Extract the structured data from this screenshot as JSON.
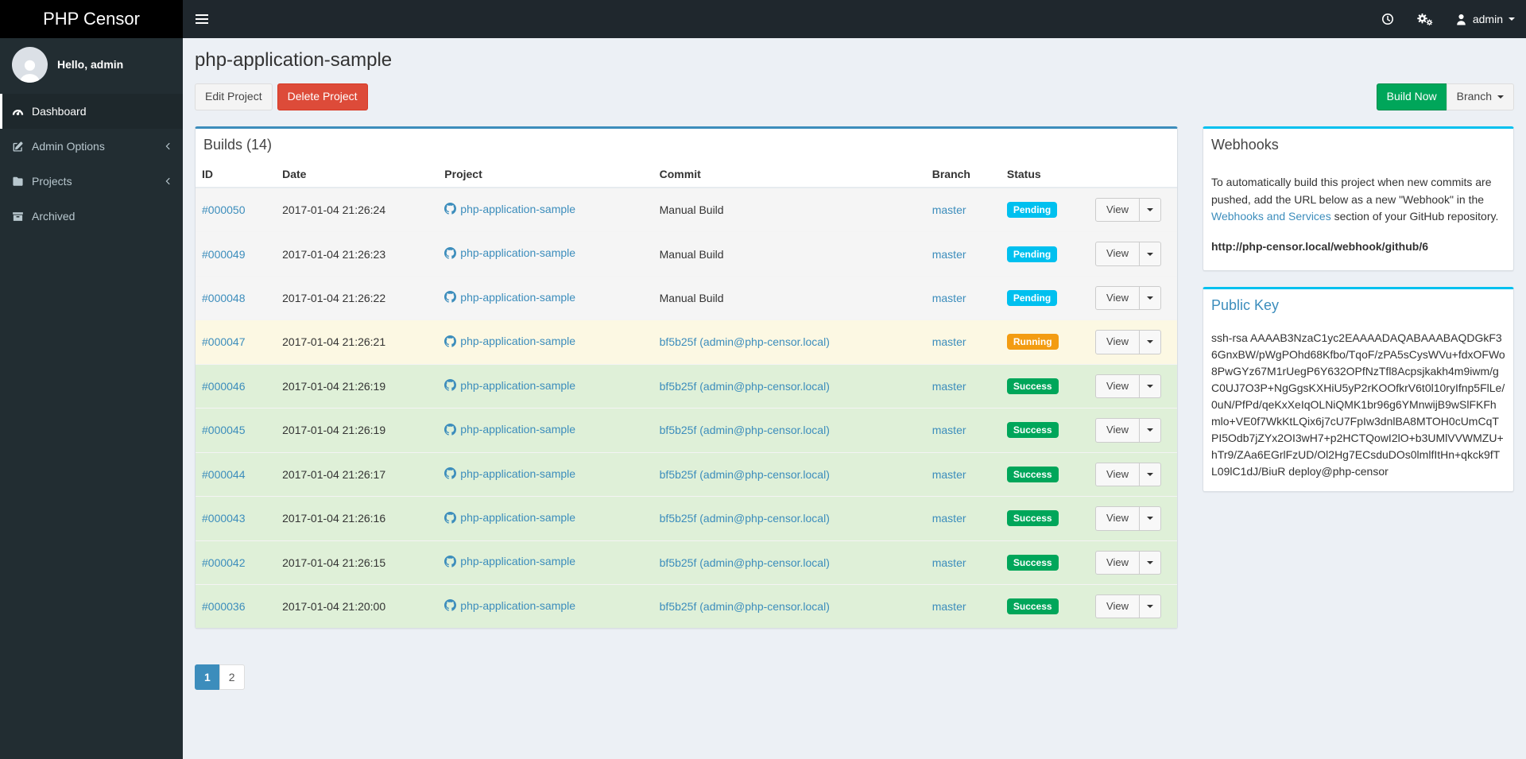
{
  "colors": {
    "accent": "#3c8dbc",
    "info": "#00c0ef",
    "warning": "#f39c12",
    "success": "#00a65a",
    "danger": "#dd4b39",
    "navbar_bg": "#1f272d",
    "sidebar_bg": "#222d32",
    "logo_bg": "#000000"
  },
  "brand": {
    "title": "PHP Censor"
  },
  "navbar": {
    "user_label": "admin",
    "icons": {
      "menu": "hamburger-icon",
      "history": "clock-icon",
      "settings": "cogs-icon",
      "user": "user-icon",
      "dropdown": "chevron-down-icon"
    }
  },
  "sidebar": {
    "greeting": "Hello, admin",
    "items": [
      {
        "label": "Dashboard",
        "icon": "gauge-icon",
        "active": true,
        "chevron": false
      },
      {
        "label": "Admin Options",
        "icon": "edit-icon",
        "active": false,
        "chevron": true
      },
      {
        "label": "Projects",
        "icon": "folder-icon",
        "active": false,
        "chevron": true
      },
      {
        "label": "Archived",
        "icon": "archive-icon",
        "active": false,
        "chevron": false
      }
    ]
  },
  "page": {
    "title": "php-application-sample",
    "buttons": {
      "edit": "Edit Project",
      "delete": "Delete Project",
      "build_now": "Build Now",
      "branch": "Branch"
    }
  },
  "builds": {
    "title": "Builds (14)",
    "columns": {
      "id": "ID",
      "date": "Date",
      "project": "Project",
      "commit": "Commit",
      "branch": "Branch",
      "status": "Status"
    },
    "view_button": "View",
    "rows": [
      {
        "id": "#000050",
        "date": "2017-01-04 21:26:24",
        "project": "php-application-sample",
        "commit": "Manual Build",
        "commit_link": false,
        "branch": "master",
        "status": "Pending"
      },
      {
        "id": "#000049",
        "date": "2017-01-04 21:26:23",
        "project": "php-application-sample",
        "commit": "Manual Build",
        "commit_link": false,
        "branch": "master",
        "status": "Pending"
      },
      {
        "id": "#000048",
        "date": "2017-01-04 21:26:22",
        "project": "php-application-sample",
        "commit": "Manual Build",
        "commit_link": false,
        "branch": "master",
        "status": "Pending"
      },
      {
        "id": "#000047",
        "date": "2017-01-04 21:26:21",
        "project": "php-application-sample",
        "commit": "bf5b25f (admin@php-censor.local)",
        "commit_link": true,
        "branch": "master",
        "status": "Running"
      },
      {
        "id": "#000046",
        "date": "2017-01-04 21:26:19",
        "project": "php-application-sample",
        "commit": "bf5b25f (admin@php-censor.local)",
        "commit_link": true,
        "branch": "master",
        "status": "Success"
      },
      {
        "id": "#000045",
        "date": "2017-01-04 21:26:19",
        "project": "php-application-sample",
        "commit": "bf5b25f (admin@php-censor.local)",
        "commit_link": true,
        "branch": "master",
        "status": "Success"
      },
      {
        "id": "#000044",
        "date": "2017-01-04 21:26:17",
        "project": "php-application-sample",
        "commit": "bf5b25f (admin@php-censor.local)",
        "commit_link": true,
        "branch": "master",
        "status": "Success"
      },
      {
        "id": "#000043",
        "date": "2017-01-04 21:26:16",
        "project": "php-application-sample",
        "commit": "bf5b25f (admin@php-censor.local)",
        "commit_link": true,
        "branch": "master",
        "status": "Success"
      },
      {
        "id": "#000042",
        "date": "2017-01-04 21:26:15",
        "project": "php-application-sample",
        "commit": "bf5b25f (admin@php-censor.local)",
        "commit_link": true,
        "branch": "master",
        "status": "Success"
      },
      {
        "id": "#000036",
        "date": "2017-01-04 21:20:00",
        "project": "php-application-sample",
        "commit": "bf5b25f (admin@php-censor.local)",
        "commit_link": true,
        "branch": "master",
        "status": "Success"
      }
    ],
    "pagination": [
      {
        "label": "1",
        "active": true
      },
      {
        "label": "2",
        "active": false
      }
    ]
  },
  "webhooks": {
    "title": "Webhooks",
    "text_before": "To automatically build this project when new commits are pushed, add the URL below as a new \"Webhook\" in the ",
    "link_text": "Webhooks and Services",
    "text_after": " section of your GitHub repository.",
    "url": "http://php-censor.local/webhook/github/6"
  },
  "public_key": {
    "title": "Public Key",
    "key": "ssh-rsa AAAAB3NzaC1yc2EAAAADAQABAAABAQDGkF36GnxBW/pWgPOhd68Kfbo/TqoF/zPA5sCysWVu+fdxOFWo8PwGYz67M1rUegP6Y632OPfNzTfl8Acpsjkakh4m9iwm/gC0UJ7O3P+NgGgsKXHiU5yP2rKOOfkrV6t0l10ryIfnp5FlLe/0uN/PfPd/qeKxXeIqOLNiQMK1br96g6YMnwijB9wSlFKFhmlo+VE0f7WkKtLQix6j7cU7FpIw3dnlBA8MTOH0cUmCqTPI5Odb7jZYx2OI3wH7+p2HCTQowI2lO+b3UMlVVWMZU+hTr9/ZAa6EGrlFzUD/Ol2Hg7ECsduDOs0lmlfItHn+qkck9fTL09lC1dJ/BiuR deploy@php-censor"
  }
}
